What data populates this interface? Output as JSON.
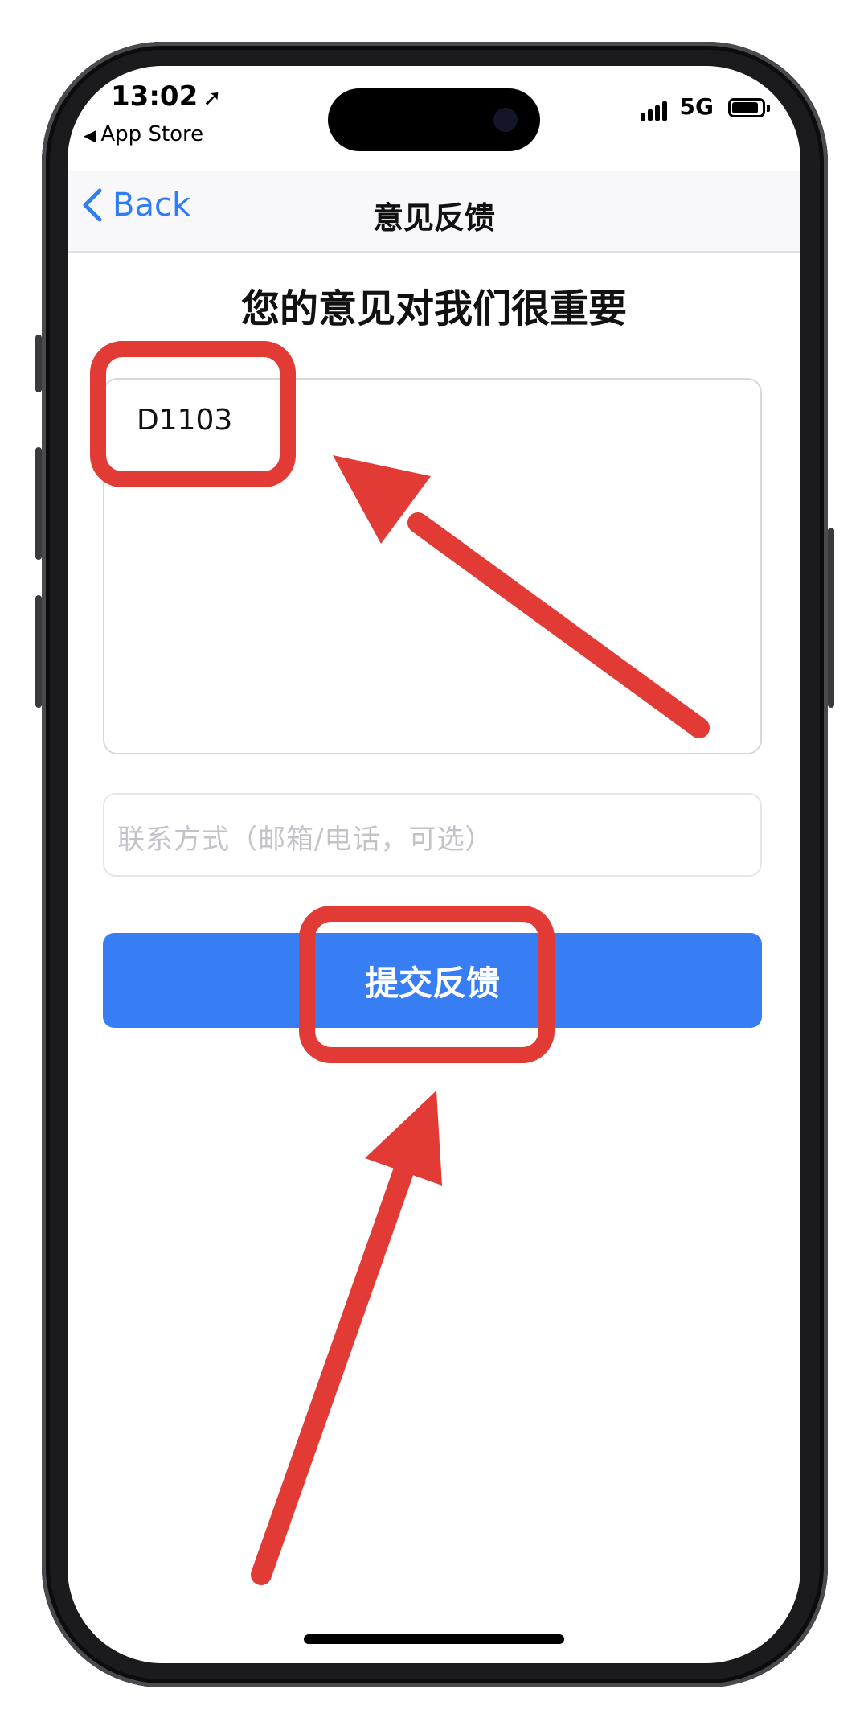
{
  "status_bar": {
    "time": "13:02",
    "back_app_label": "App Store",
    "network": "5G"
  },
  "nav": {
    "back_label": "Back",
    "title": "意见反馈"
  },
  "main": {
    "heading": "您的意见对我们很重要",
    "feedback_value": "D1103",
    "contact_placeholder": "联系方式（邮箱/电话，可选）",
    "submit_label": "提交反馈"
  },
  "colors": {
    "accent": "#377ef4",
    "link": "#2f7cf6",
    "annotation": "#e23a35"
  },
  "icons": {
    "location": "location-arrow-icon",
    "back": "chevron-left-icon",
    "signal": "signal-bars-icon",
    "battery": "battery-icon"
  }
}
